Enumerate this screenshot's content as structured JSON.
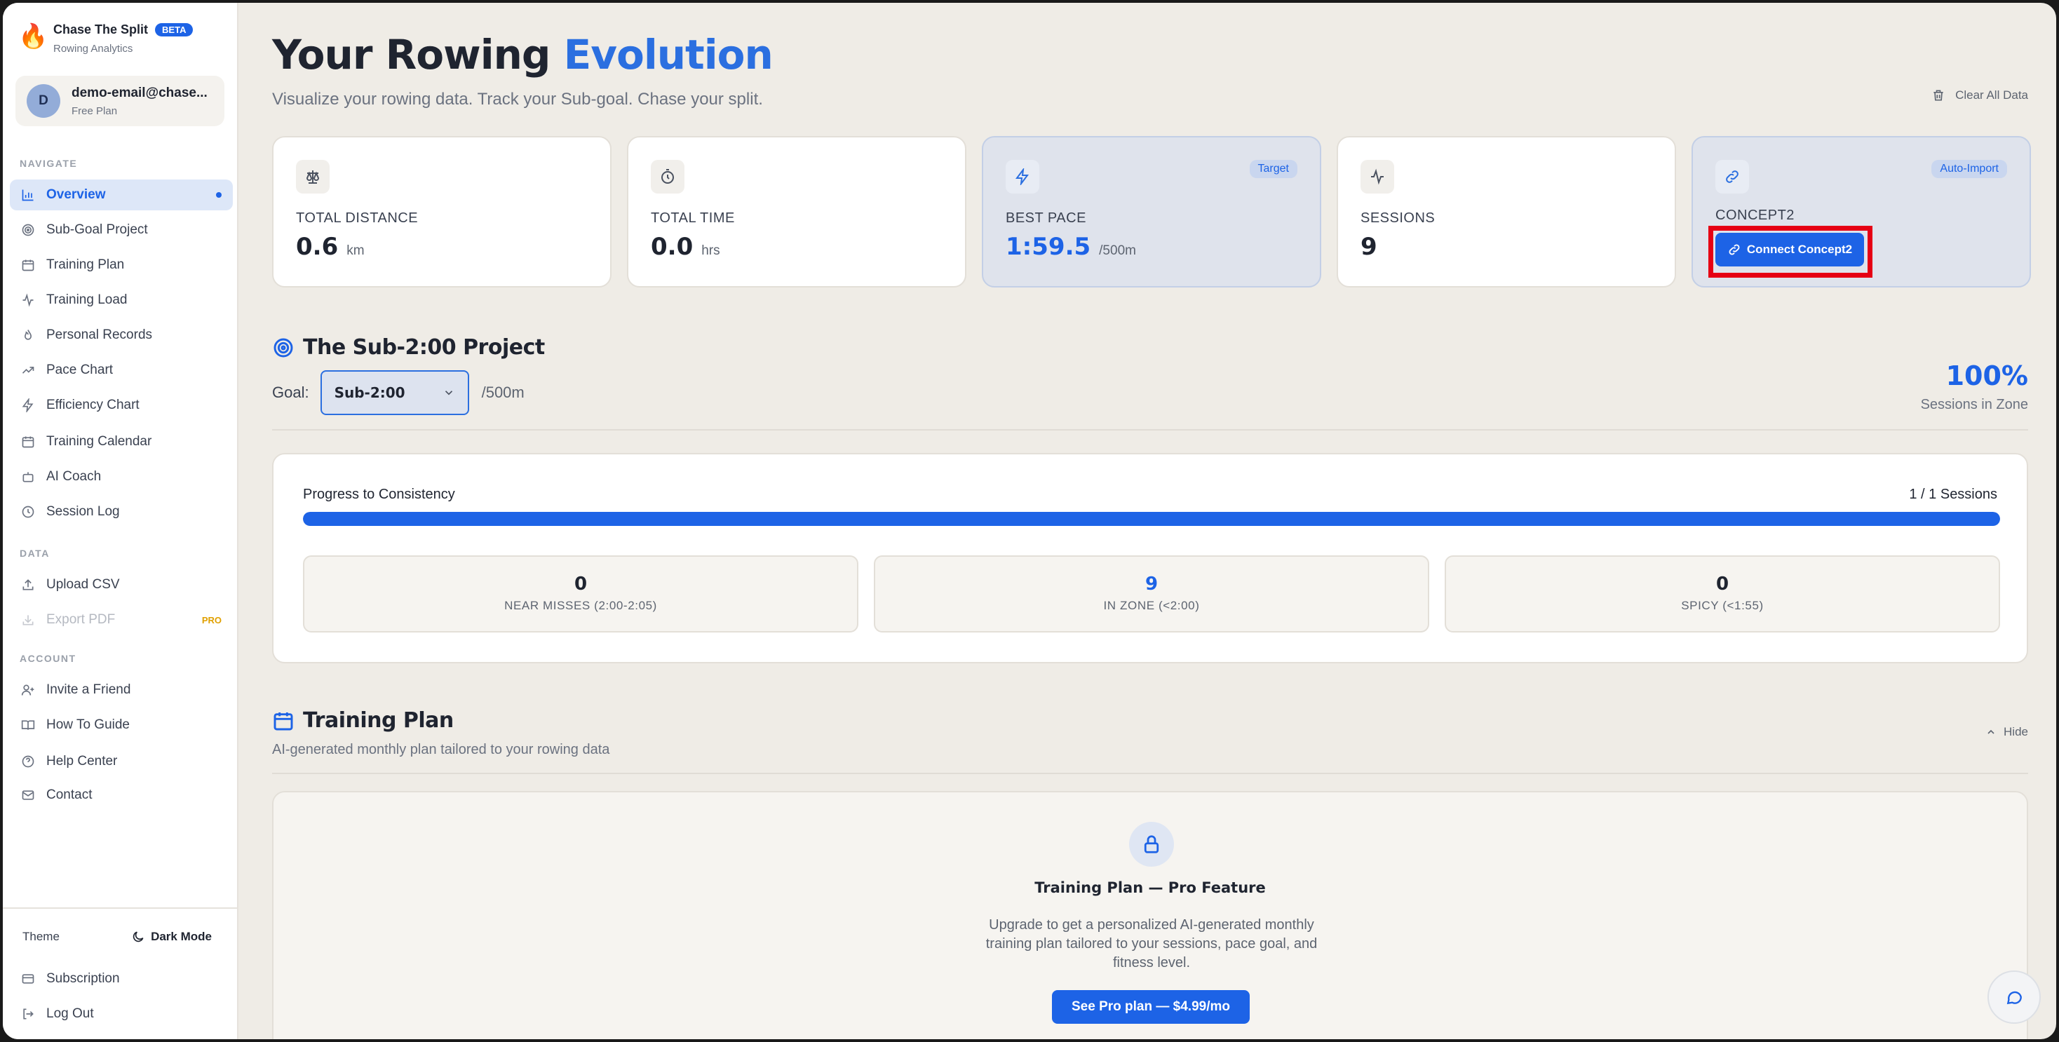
{
  "brand": {
    "name": "Chase The Split",
    "badge": "BETA",
    "subtitle": "Rowing Analytics"
  },
  "user": {
    "initial": "D",
    "email": "demo-email@chase...",
    "plan": "Free Plan"
  },
  "nav": {
    "navigate_label": "NAVIGATE",
    "items": [
      {
        "label": "Overview",
        "icon": "bar-chart-icon"
      },
      {
        "label": "Sub-Goal Project",
        "icon": "target-icon"
      },
      {
        "label": "Training Plan",
        "icon": "calendar-icon"
      },
      {
        "label": "Training Load",
        "icon": "activity-icon"
      },
      {
        "label": "Personal Records",
        "icon": "flame-icon"
      },
      {
        "label": "Pace Chart",
        "icon": "trending-up-icon"
      },
      {
        "label": "Efficiency Chart",
        "icon": "zap-icon"
      },
      {
        "label": "Training Calendar",
        "icon": "calendar-icon"
      },
      {
        "label": "AI Coach",
        "icon": "bot-icon"
      },
      {
        "label": "Session Log",
        "icon": "clock-icon"
      }
    ],
    "data_label": "DATA",
    "data_items": [
      {
        "label": "Upload CSV",
        "icon": "upload-icon"
      },
      {
        "label": "Export PDF",
        "icon": "download-icon",
        "tag": "PRO"
      }
    ],
    "account_label": "ACCOUNT",
    "account_items": [
      {
        "label": "Invite a Friend",
        "icon": "user-plus-icon"
      },
      {
        "label": "How To Guide",
        "icon": "book-icon"
      },
      {
        "label": "Help Center",
        "icon": "help-circle-icon"
      },
      {
        "label": "Contact",
        "icon": "mail-icon"
      }
    ]
  },
  "footer": {
    "theme_label": "Theme",
    "dark_mode": "Dark Mode",
    "subscription": "Subscription",
    "logout": "Log Out"
  },
  "header": {
    "title_main": "Your Rowing ",
    "title_accent": "Evolution",
    "subtitle": "Visualize your rowing data. Track your Sub-goal. Chase your split.",
    "clear": "Clear All Data"
  },
  "stats": [
    {
      "label": "TOTAL DISTANCE",
      "value": "0.6",
      "unit": "km",
      "icon": "scale-icon"
    },
    {
      "label": "TOTAL TIME",
      "value": "0.0",
      "unit": "hrs",
      "icon": "stopwatch-icon"
    },
    {
      "label": "BEST PACE",
      "value": "1:59.5",
      "unit": "/500m",
      "badge": "Target",
      "icon": "zap-icon"
    },
    {
      "label": "SESSIONS",
      "value": "9",
      "icon": "activity-icon"
    },
    {
      "label": "CONCEPT2",
      "badge": "Auto-Import",
      "button": "Connect Concept2",
      "icon": "link-icon"
    }
  ],
  "subgoal": {
    "title": "The Sub-2:00 Project",
    "goal_label": "Goal:",
    "goal_value": "Sub-2:00",
    "goal_unit": "/500m",
    "percent": "100%",
    "percent_label": "Sessions in Zone"
  },
  "progress": {
    "label": "Progress to Consistency",
    "count": "1 / 1 Sessions",
    "fraction": 1.0,
    "zones": [
      {
        "value": "0",
        "label": "NEAR MISSES (2:00-2:05)"
      },
      {
        "value": "9",
        "label": "IN ZONE (<2:00)"
      },
      {
        "value": "0",
        "label": "SPICY (<1:55)"
      }
    ]
  },
  "plan": {
    "title": "Training Plan",
    "hide": "Hide",
    "subtitle": "AI-generated monthly plan tailored to your rowing data",
    "pro_title": "Training Plan — Pro Feature",
    "pro_desc": "Upgrade to get a personalized AI-generated monthly training plan tailored to your sessions, pace goal, and fitness level.",
    "pro_button": "See Pro plan — $4.99/mo"
  },
  "colors": {
    "accent": "#1d63e6",
    "highlight": "#e60014",
    "background": "#efece6"
  }
}
